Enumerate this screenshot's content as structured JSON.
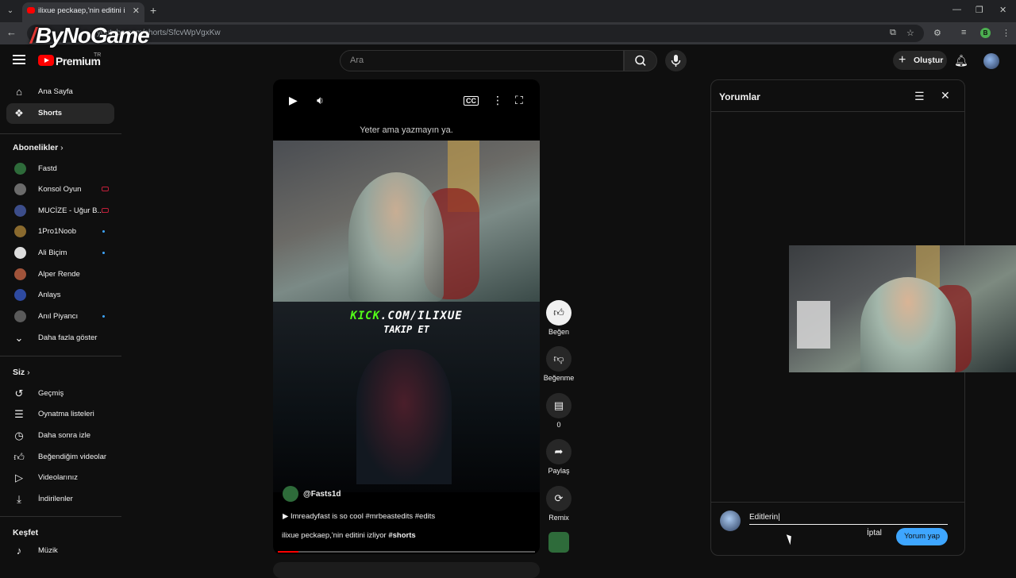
{
  "browser": {
    "tab_title": "ilixue peckaep,'nin editini izliyor",
    "url": "youtube.com/shorts/SfcvWpVgxKw",
    "profile_initial": "B"
  },
  "watermark": "ByNoGame",
  "header": {
    "brand": "Premium",
    "region": "TR",
    "search_placeholder": "Ara",
    "create_label": "Oluştur"
  },
  "sidebar": {
    "primary": [
      {
        "label": "Ana Sayfa",
        "icon": "home-icon"
      },
      {
        "label": "Shorts",
        "icon": "shorts-icon"
      }
    ],
    "subscriptions_title": "Abonelikler",
    "subscriptions": [
      {
        "label": "Fastd",
        "status": "none",
        "color": "#2e6b3a"
      },
      {
        "label": "Konsol Oyun",
        "status": "live",
        "color": "#6b6b6b"
      },
      {
        "label": "MUCİZE - Uğur B...",
        "status": "live",
        "color": "#3c4d8a"
      },
      {
        "label": "1Pro1Noob",
        "status": "new",
        "color": "#8a6a2e"
      },
      {
        "label": "Ali Biçim",
        "status": "new",
        "color": "#dddddd"
      },
      {
        "label": "Alper Rende",
        "status": "none",
        "color": "#a0533a"
      },
      {
        "label": "Anlays",
        "status": "none",
        "color": "#2e4aa0"
      },
      {
        "label": "Anıl Piyancı",
        "status": "new",
        "color": "#5a5a5a"
      }
    ],
    "show_more": "Daha fazla göster",
    "you_title": "Siz",
    "you_items": [
      {
        "label": "Geçmiş",
        "icon": "history-icon"
      },
      {
        "label": "Oynatma listeleri",
        "icon": "playlist-icon"
      },
      {
        "label": "Daha sonra izle",
        "icon": "watch-later-icon"
      },
      {
        "label": "Beğendiğim videolar",
        "icon": "thumb-up-icon"
      },
      {
        "label": "Videolarınız",
        "icon": "your-videos-icon"
      },
      {
        "label": "İndirilenler",
        "icon": "download-icon"
      }
    ],
    "explore_title": "Keşfet",
    "explore_items": [
      {
        "label": "Müzik",
        "icon": "music-icon"
      }
    ]
  },
  "player": {
    "caption": "Yeter ama yazmayın ya.",
    "overlay_kick_green": "KICK",
    "overlay_kick_rest": ".COM/ILIXUE",
    "overlay_takip": "TAKIP ET",
    "channel": "@Fasts1d",
    "song": "Imreadyfast is so cool #mrbeastedits #edits",
    "title": "ilixue peckaep,'nin editini izliyor",
    "hashtag": "#shorts",
    "progress": 0.08
  },
  "actions": {
    "like_label": "Beğen",
    "dislike_label": "Beğenme",
    "comments_count": "0",
    "share_label": "Paylaş",
    "remix_label": "Remix"
  },
  "comments": {
    "title": "Yorumlar",
    "input_value": "Editlerin|",
    "cancel_label": "İptal",
    "submit_label": "Yorum yap"
  }
}
